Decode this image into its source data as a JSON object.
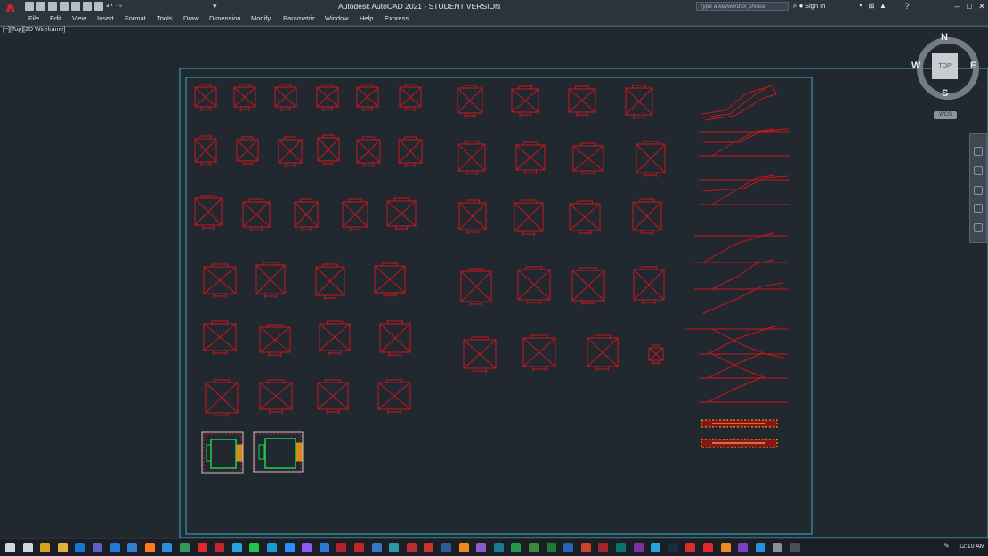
{
  "app": {
    "title": "Autodesk AutoCAD 2021 - STUDENT VERSION",
    "logo_letter": "A",
    "search_placeholder": "Type a keyword or phrase",
    "sign_in": "Sign In",
    "accent_color": "#d0242b",
    "window_controls": [
      "–",
      "□",
      "✕"
    ]
  },
  "quick_access": [
    "new-icon",
    "open-icon",
    "save-icon",
    "save-as-icon",
    "plot-preview-icon",
    "publish-icon",
    "print-icon",
    "undo-icon",
    "redo-icon",
    "customize-icon"
  ],
  "menu": [
    "File",
    "Edit",
    "View",
    "Insert",
    "Format",
    "Tools",
    "Draw",
    "Dimension",
    "Modify",
    "Parametric",
    "Window",
    "Help",
    "Express"
  ],
  "viewport": {
    "label": "[−][Top][2D Wireframe]",
    "drawing_color": "#c8171c",
    "border_color": "#35b5c2"
  },
  "viewcube": {
    "face": "TOP",
    "north": "N",
    "south": "S",
    "east": "E",
    "west": "W",
    "ucs": "WCS"
  },
  "navbar": [
    "full-navigation-wheel-icon",
    "pan-icon",
    "zoom-extents-icon",
    "orbit-icon",
    "showmotion-icon"
  ],
  "taskbar": {
    "clock": "12:10 AM",
    "icons": [
      "windows-start-icon",
      "search-icon",
      "store-icon",
      "file-explorer-icon",
      "outlook-icon",
      "teams-icon",
      "mail-icon",
      "photos-icon",
      "firefox-icon",
      "edge-icon",
      "chrome-icon",
      "opera-icon",
      "acrobat-icon",
      "telegram-icon",
      "whatsapp-icon",
      "skype-icon",
      "zoom-icon",
      "messenger-icon",
      "onedrive-icon",
      "autocad-icon",
      "autocad-lt-icon",
      "revit-icon",
      "navisworks-icon",
      "recap-icon",
      "sketchup-icon",
      "photoshop-icon",
      "illustrator-icon",
      "premiere-icon",
      "audition-icon",
      "excel-icon",
      "project-icon",
      "excel-2-icon",
      "word-icon",
      "powerpoint-icon",
      "access-icon",
      "publisher-icon",
      "onenote-icon",
      "snipping-icon",
      "steam-icon",
      "mega-icon",
      "chrome-2-icon",
      "vlc-icon",
      "media-player-icon",
      "photos-2-icon",
      "settings-icon",
      "calculator-icon"
    ]
  }
}
